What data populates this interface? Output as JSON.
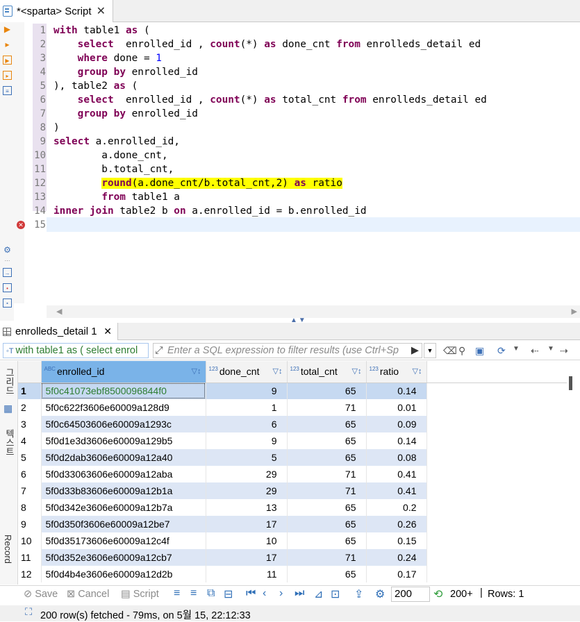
{
  "editor_tab": {
    "title": "*<sparta> Script",
    "close": "✕"
  },
  "code_lines": [
    {
      "n": "1",
      "parts": [
        {
          "t": "with",
          "k": "kw"
        },
        {
          "t": " table1 "
        },
        {
          "t": "as",
          "k": "kw"
        },
        {
          "t": " ("
        }
      ]
    },
    {
      "n": "2",
      "parts": [
        {
          "t": "    "
        },
        {
          "t": "select",
          "k": "kw"
        },
        {
          "t": "  enrolled_id , "
        },
        {
          "t": "count",
          "k": "kw"
        },
        {
          "t": "(*) "
        },
        {
          "t": "as",
          "k": "kw"
        },
        {
          "t": " done_cnt "
        },
        {
          "t": "from",
          "k": "kw"
        },
        {
          "t": " enrolleds_detail ed"
        }
      ]
    },
    {
      "n": "3",
      "parts": [
        {
          "t": "    "
        },
        {
          "t": "where",
          "k": "kw"
        },
        {
          "t": " done = "
        },
        {
          "t": "1",
          "k": "num"
        }
      ]
    },
    {
      "n": "4",
      "parts": [
        {
          "t": "    "
        },
        {
          "t": "group",
          "k": "kw"
        },
        {
          "t": " "
        },
        {
          "t": "by",
          "k": "kw"
        },
        {
          "t": " enrolled_id"
        }
      ]
    },
    {
      "n": "5",
      "parts": [
        {
          "t": "), table2 "
        },
        {
          "t": "as",
          "k": "kw"
        },
        {
          "t": " ("
        }
      ]
    },
    {
      "n": "6",
      "parts": [
        {
          "t": "    "
        },
        {
          "t": "select",
          "k": "kw"
        },
        {
          "t": "  enrolled_id , "
        },
        {
          "t": "count",
          "k": "kw"
        },
        {
          "t": "(*) "
        },
        {
          "t": "as",
          "k": "kw"
        },
        {
          "t": " total_cnt "
        },
        {
          "t": "from",
          "k": "kw"
        },
        {
          "t": " enrolleds_detail ed"
        }
      ]
    },
    {
      "n": "7",
      "parts": [
        {
          "t": "    "
        },
        {
          "t": "group",
          "k": "kw"
        },
        {
          "t": " "
        },
        {
          "t": "by",
          "k": "kw"
        },
        {
          "t": " enrolled_id"
        }
      ]
    },
    {
      "n": "8",
      "parts": [
        {
          "t": ")"
        }
      ]
    },
    {
      "n": "9",
      "parts": [
        {
          "t": "select",
          "k": "kw"
        },
        {
          "t": " a.enrolled_id,"
        }
      ]
    },
    {
      "n": "10",
      "parts": [
        {
          "t": "        a.done_cnt,"
        }
      ]
    },
    {
      "n": "11",
      "parts": [
        {
          "t": "        b.total_cnt,"
        }
      ]
    },
    {
      "n": "12",
      "parts": [
        {
          "t": "        "
        },
        {
          "t": "round",
          "k": "kw hl"
        },
        {
          "t": "(a.done_cnt/b.total_cnt,2) ",
          "k": "hl"
        },
        {
          "t": "as",
          "k": "kw hl"
        },
        {
          "t": " ratio",
          "k": "hl"
        }
      ]
    },
    {
      "n": "13",
      "parts": [
        {
          "t": "        "
        },
        {
          "t": "from",
          "k": "kw"
        },
        {
          "t": " table1 a"
        }
      ]
    },
    {
      "n": "14",
      "parts": [
        {
          "t": "inner",
          "k": "kw"
        },
        {
          "t": " "
        },
        {
          "t": "join",
          "k": "kw"
        },
        {
          "t": " table2 b "
        },
        {
          "t": "on",
          "k": "kw"
        },
        {
          "t": " a.enrolled_id = b.enrolled_id"
        }
      ]
    },
    {
      "n": "15",
      "parts": []
    }
  ],
  "results_tab": {
    "title": "enrolleds_detail 1",
    "close": "✕"
  },
  "filter": {
    "query_text": "with table1 as ( select enrol",
    "placeholder": "Enter a SQL expression to filter results (use Ctrl+Sp"
  },
  "side_tabs": {
    "grid": "그리드",
    "text": "텍스트",
    "record": "Record"
  },
  "columns": [
    {
      "type": "ABC",
      "name": "enrolled_id"
    },
    {
      "type": "123",
      "name": "done_cnt"
    },
    {
      "type": "123",
      "name": "total_cnt"
    },
    {
      "type": "123",
      "name": "ratio"
    }
  ],
  "rows": [
    {
      "n": "1",
      "id": "5f0c41073ebf8500096844f0",
      "done": "9",
      "total": "65",
      "ratio": "0.14"
    },
    {
      "n": "2",
      "id": "5f0c622f3606e60009a128d9",
      "done": "1",
      "total": "71",
      "ratio": "0.01"
    },
    {
      "n": "3",
      "id": "5f0c64503606e60009a1293c",
      "done": "6",
      "total": "65",
      "ratio": "0.09"
    },
    {
      "n": "4",
      "id": "5f0d1e3d3606e60009a129b5",
      "done": "9",
      "total": "65",
      "ratio": "0.14"
    },
    {
      "n": "5",
      "id": "5f0d2dab3606e60009a12a40",
      "done": "5",
      "total": "65",
      "ratio": "0.08"
    },
    {
      "n": "6",
      "id": "5f0d33063606e60009a12aba",
      "done": "29",
      "total": "71",
      "ratio": "0.41"
    },
    {
      "n": "7",
      "id": "5f0d33b83606e60009a12b1a",
      "done": "29",
      "total": "71",
      "ratio": "0.41"
    },
    {
      "n": "8",
      "id": "5f0d342e3606e60009a12b7a",
      "done": "13",
      "total": "65",
      "ratio": "0.2"
    },
    {
      "n": "9",
      "id": "5f0d350f3606e60009a12be7",
      "done": "17",
      "total": "65",
      "ratio": "0.26"
    },
    {
      "n": "10",
      "id": "5f0d35173606e60009a12c4f",
      "done": "10",
      "total": "65",
      "ratio": "0.15"
    },
    {
      "n": "11",
      "id": "5f0d352e3606e60009a12cb7",
      "done": "17",
      "total": "71",
      "ratio": "0.24"
    },
    {
      "n": "12",
      "id": "5f0d4b4e3606e60009a12d2b",
      "done": "11",
      "total": "65",
      "ratio": "0.17"
    }
  ],
  "bottom": {
    "save": "Save",
    "cancel": "Cancel",
    "script": "Script",
    "rows_value": "200",
    "fetch_more": "200+",
    "rows_label": "Rows: 1"
  },
  "status": {
    "text": "200 row(s) fetched - 79ms, on 5월 15, 22:12:33"
  }
}
